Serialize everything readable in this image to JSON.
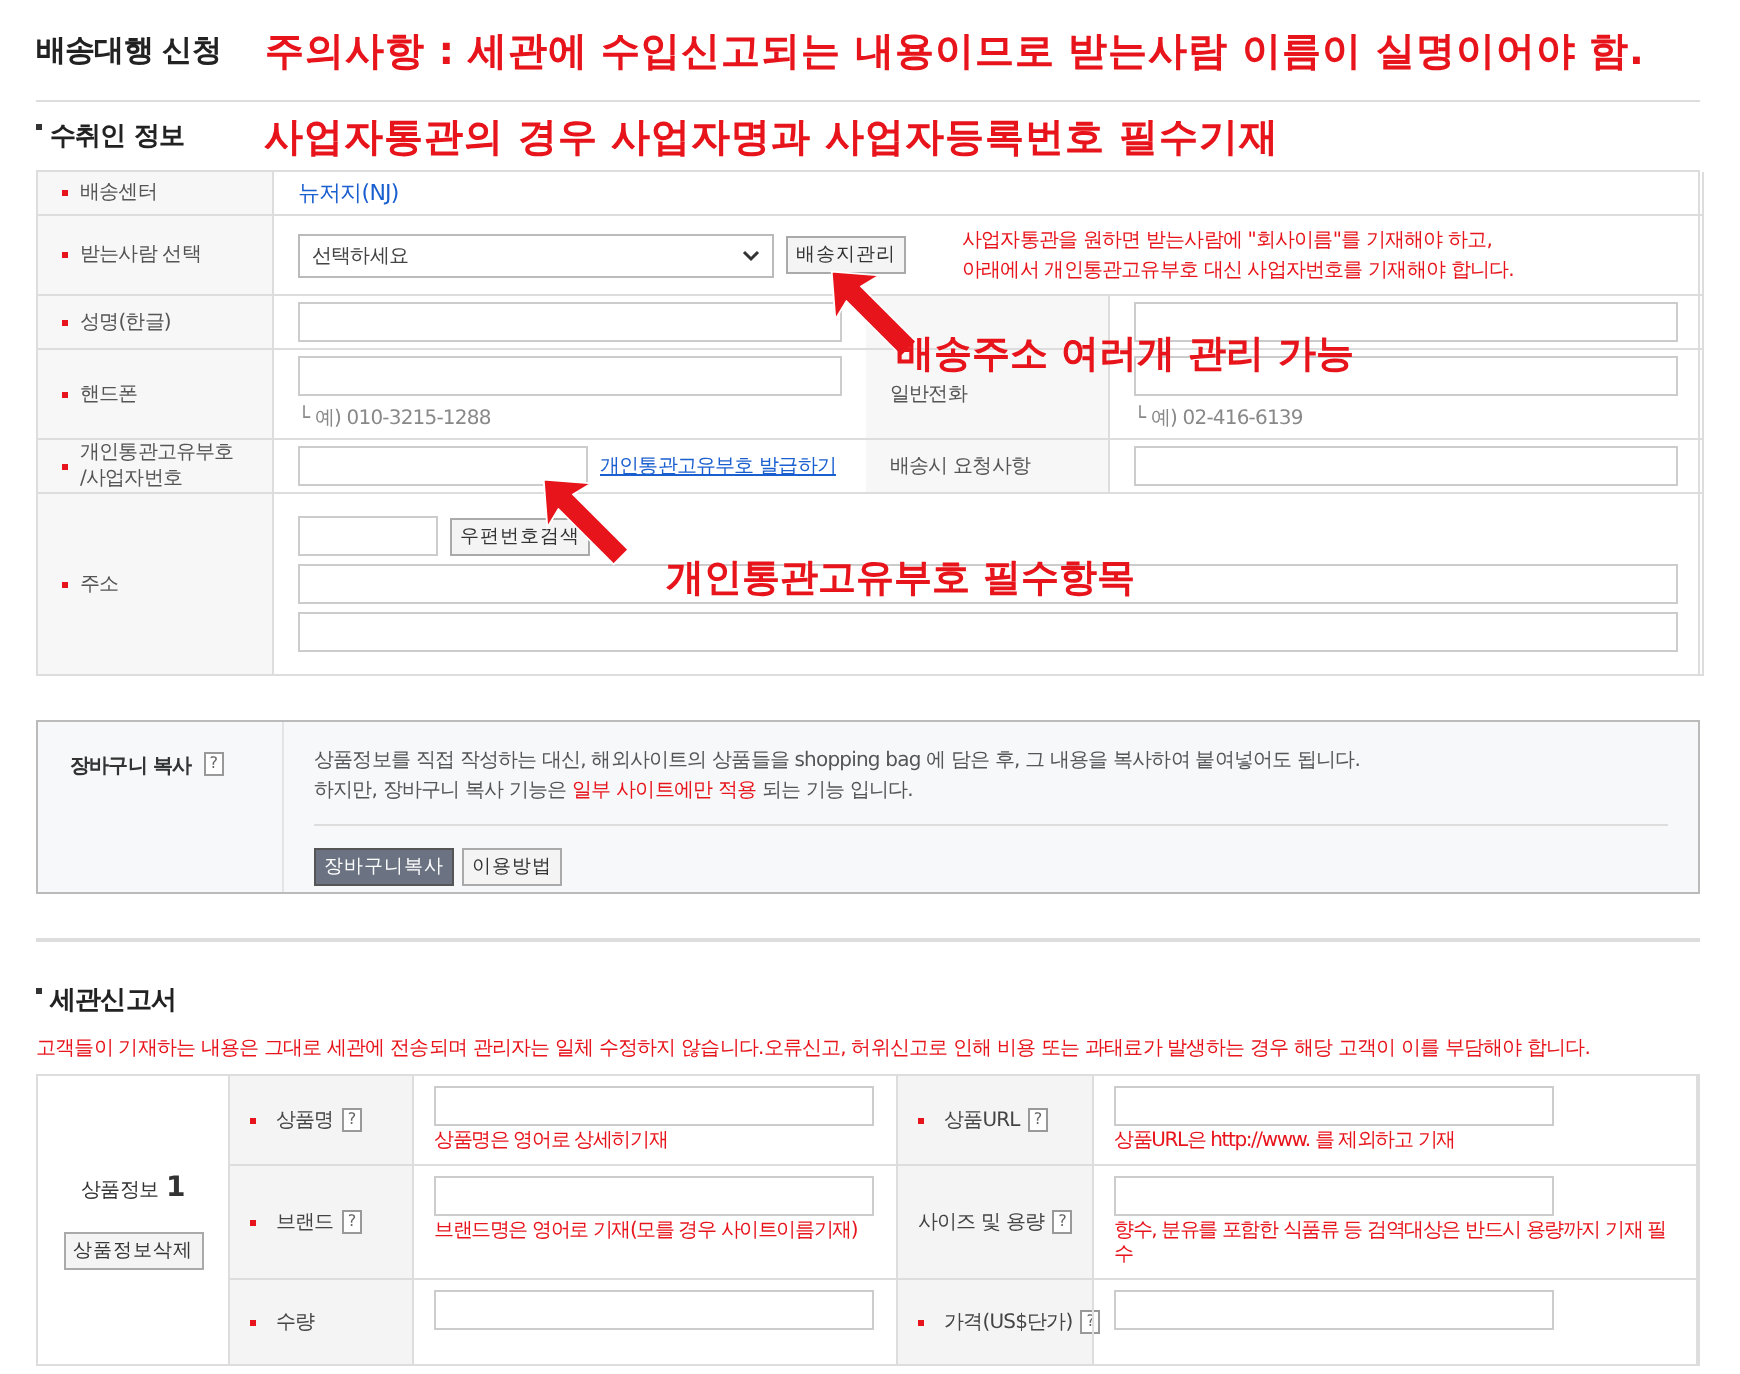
{
  "title": "배송대행 신청",
  "notices": [
    "주의사항 : 세관에 수입신고되는 내용이므로 받는사람 이름이 실명이어야 함.",
    "사업자통관의 경우 사업자명과 사업자등록번호 필수기재"
  ],
  "recipient": {
    "heading": "수취인 정보",
    "rows": [
      {
        "kind": "text",
        "label": "배송센터",
        "required": true,
        "value": "뉴저지(NJ)"
      },
      {
        "kind": "select",
        "label": "받는사람 선택",
        "required": true,
        "select": "선택하세요",
        "button": "배송지관리",
        "hint": [
          "사업자통관을 원하면 받는사람에 \"회사이름\"를 기재해야 하고,",
          "아래에서 개인통관고유부호 대신 사업자번호를 기재해야 합니다."
        ]
      },
      {
        "kind": "pair",
        "cells": [
          {
            "label": "성명(한글)",
            "required": true
          },
          {
            "required": false
          }
        ]
      },
      {
        "kind": "pair",
        "cells": [
          {
            "label": "핸드폰",
            "required": true,
            "example": "└ 예) 010-3215-1288"
          },
          {
            "label": "일반전화",
            "required": false,
            "example": "└ 예) 02-416-6139"
          }
        ]
      },
      {
        "kind": "pair",
        "cells": [
          {
            "label": "개인통관고유부호\n/사업자번호",
            "required": true,
            "link": "개인통관고유부호 발급하기"
          },
          {
            "label": "배송시 요청사항",
            "required": false
          }
        ]
      },
      {
        "kind": "address",
        "label": "주소",
        "required": true,
        "button": "우편번호검색"
      }
    ]
  },
  "annotations": [
    {
      "text": "배송주소 여러개 관리 가능"
    },
    {
      "text": "개인통관고유부호 필수항목"
    }
  ],
  "cart": {
    "label": "장바구니 복사",
    "help": "?",
    "line1": "상품정보를 직접 작성하는 대신, 해외사이트의 상품들을 shopping bag 에 담은 후, 그 내용을 복사하여 붙여넣어도 됩니다.",
    "line2": [
      {
        "text": "하지만, 장바구니 복사 기능은 ",
        "red": false
      },
      {
        "text": "일부 사이트에만 적용",
        "red": true
      },
      {
        "text": " 되는 기능 입니다.",
        "red": false
      }
    ],
    "buttons": [
      {
        "label": "장바구니복사",
        "primary": true
      },
      {
        "label": "이용방법",
        "primary": false
      }
    ]
  },
  "customs": {
    "heading": "세관신고서",
    "notice": "고객들이 기재하는 내용은 그대로 세관에 전송되며 관리자는 일체 수정하지 않습니다.오류신고, 허위신고로 인해 비용 또는 과태료가 발생하는 경우 해당 고객이 이를 부담해야 합니다.",
    "product": {
      "label": "상품정보",
      "number": "1",
      "button": "상품정보삭제",
      "fields": [
        {
          "label": "상품명",
          "required": true,
          "help": "?",
          "hint": "상품명은 영어로 상세히기재"
        },
        {
          "label": "상품URL",
          "required": true,
          "help": "?",
          "hint": "상품URL은 http://www. 를 제외하고 기재"
        },
        {
          "label": "브랜드",
          "required": true,
          "help": "?",
          "hint": "브랜드명은 영어로 기재(모를 경우 사이트이름기재)"
        },
        {
          "label": "사이즈 및 용량",
          "required": false,
          "help": "?",
          "hint": "향수, 분유를 포함한 식품류 등 검역대상은 반드시 용량까지 기재 필수"
        },
        {
          "label": "수량",
          "required": true
        },
        {
          "label": "가격(US$단가)",
          "required": true,
          "help": "?"
        }
      ]
    }
  }
}
